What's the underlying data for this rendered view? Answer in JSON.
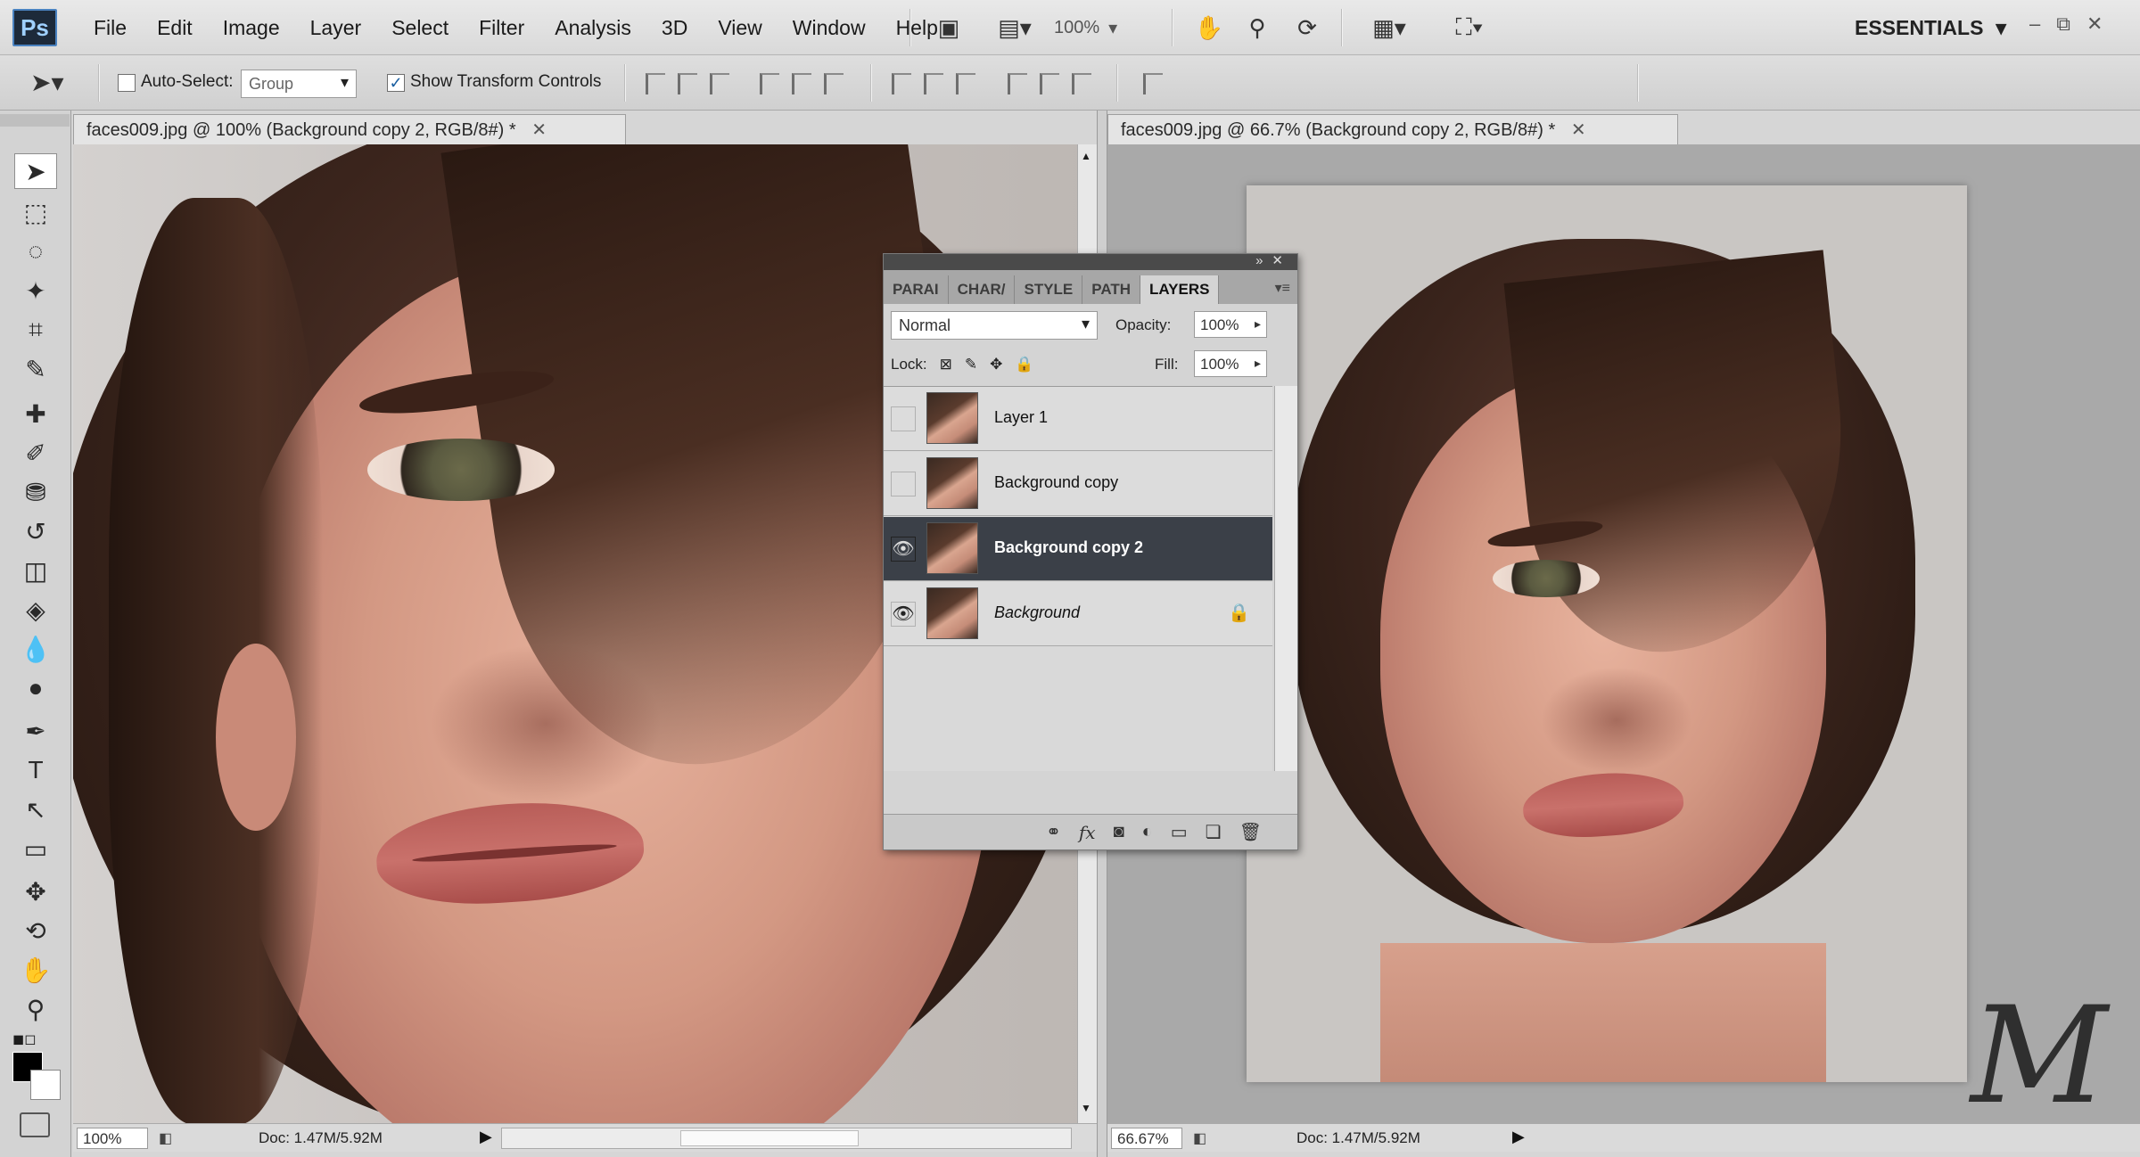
{
  "app": {
    "logo": "Ps",
    "menu": [
      "File",
      "Edit",
      "Image",
      "Layer",
      "Select",
      "Filter",
      "Analysis",
      "3D",
      "View",
      "Window",
      "Help"
    ],
    "zoom": "100%",
    "workspace": "ESSENTIALS"
  },
  "options_bar": {
    "auto_select_label": "Auto-Select:",
    "auto_select_checked": false,
    "auto_select_mode": "Group",
    "show_transform_label": "Show Transform Controls",
    "show_transform_checked": true
  },
  "tools": [
    "move-tool",
    "marquee-tool",
    "lasso-tool",
    "magic-wand-tool",
    "crop-tool",
    "eyedropper-tool",
    "healing-brush-tool",
    "brush-tool",
    "clone-stamp-tool",
    "history-brush-tool",
    "eraser-tool",
    "gradient-tool",
    "blur-tool",
    "dodge-tool",
    "pen-tool",
    "type-tool",
    "path-selection-tool",
    "shape-tool",
    "3d-rotate-tool",
    "3d-orbit-tool",
    "hand-tool",
    "zoom-tool"
  ],
  "documents": [
    {
      "tab_title": "faces009.jpg @ 100% (Background copy 2, RGB/8#) *",
      "zoom": "100%",
      "doc_size": "Doc: 1.47M/5.92M"
    },
    {
      "tab_title": "faces009.jpg @ 66.7% (Background copy 2, RGB/8#) *",
      "zoom": "66.67%",
      "doc_size": "Doc: 1.47M/5.92M"
    }
  ],
  "layers_panel": {
    "tabs": [
      "PARAI",
      "CHAR/",
      "STYLE",
      "PATH",
      "LAYERS"
    ],
    "active_tab": "LAYERS",
    "blend_mode": "Normal",
    "opacity_label": "Opacity:",
    "opacity": "100%",
    "lock_label": "Lock:",
    "fill_label": "Fill:",
    "fill": "100%",
    "layers": [
      {
        "name": "Layer 1",
        "visible": false,
        "selected": false,
        "locked": false
      },
      {
        "name": "Background copy",
        "visible": false,
        "selected": false,
        "locked": false
      },
      {
        "name": "Background copy 2",
        "visible": true,
        "selected": true,
        "locked": false
      },
      {
        "name": "Background",
        "visible": true,
        "selected": false,
        "locked": true
      }
    ],
    "footer_icons": [
      "link-icon",
      "fx-icon",
      "mask-icon",
      "adjustment-icon",
      "group-icon",
      "new-layer-icon",
      "trash-icon"
    ]
  },
  "colors": {
    "selected_layer": "#3b4048",
    "foreground": "#000000",
    "background": "#ffffff"
  }
}
